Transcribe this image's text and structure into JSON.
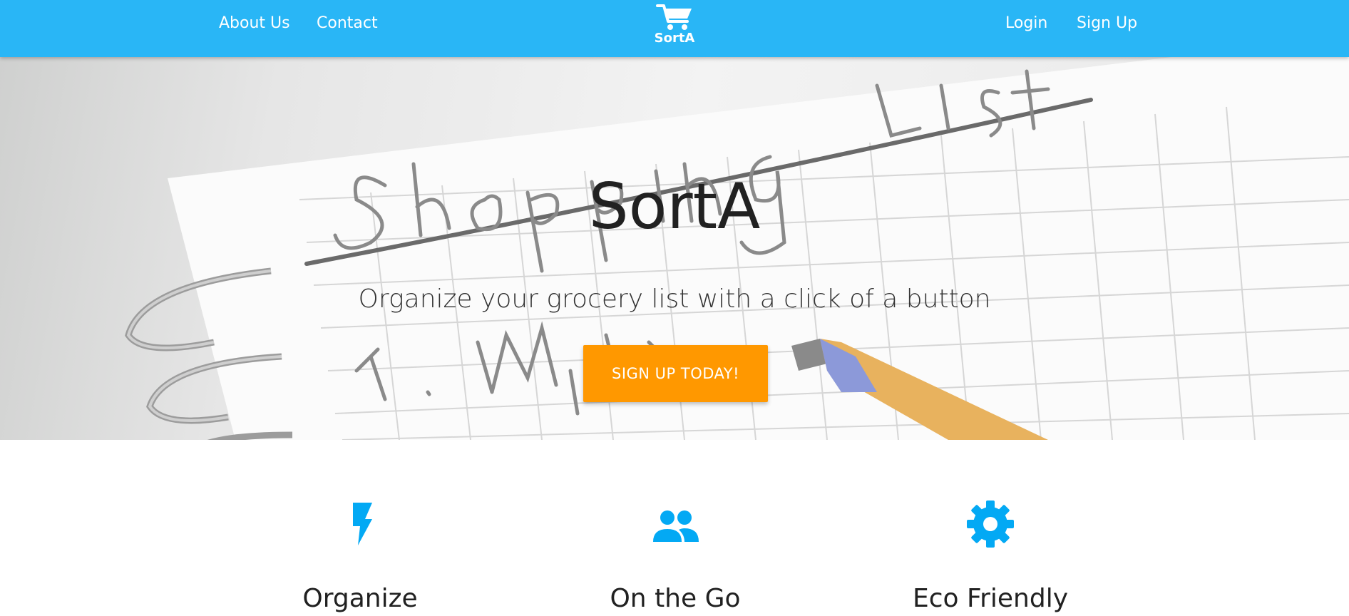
{
  "nav": {
    "about_label": "About Us",
    "contact_label": "Contact",
    "login_label": "Login",
    "signup_label": "Sign Up",
    "brand_name": "SortA",
    "brand_icon": "shopping-cart-icon",
    "background_color": "#29b6f6"
  },
  "hero": {
    "title": "SortA",
    "subtitle": "Organize your grocery list with a click of a button",
    "cta_label": "SIGN UP TODAY!",
    "cta_color": "#ff9800"
  },
  "features": [
    {
      "title": "Organize",
      "icon": "bolt-icon"
    },
    {
      "title": "On the Go",
      "icon": "people-icon"
    },
    {
      "title": "Eco Friendly",
      "icon": "gear-icon"
    }
  ],
  "accent_color": "#03a9f4"
}
